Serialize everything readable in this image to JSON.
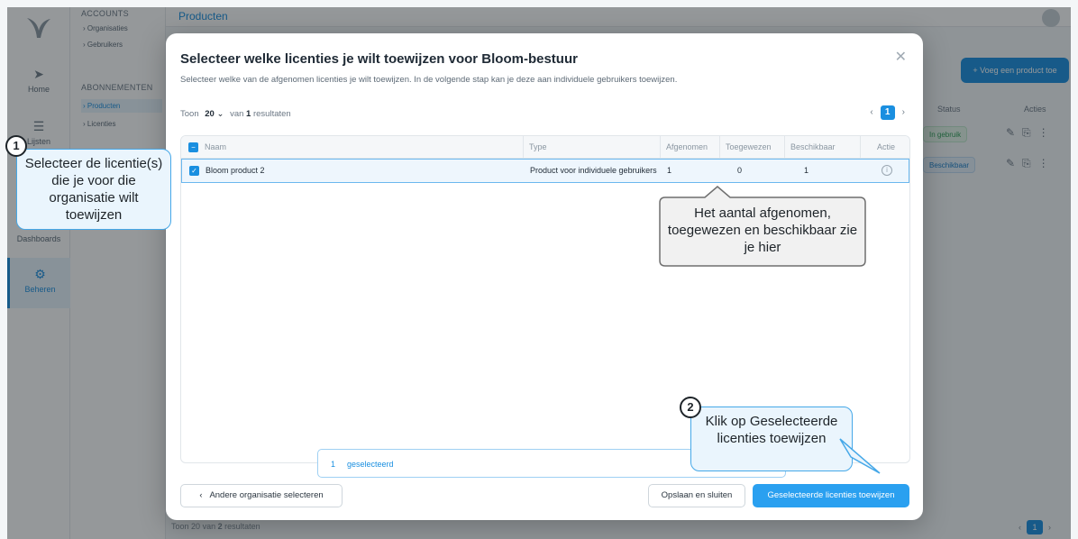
{
  "app": {
    "breadcrumb": "Producten",
    "rail": {
      "home": "Home",
      "lijsten": "Lijsten",
      "dashboards": "Dashboards",
      "beheren": "Beheren"
    },
    "subnav": {
      "accounts_head": "ACCOUNTS",
      "organisaties": "Organisaties",
      "gebruikers": "Gebruikers",
      "abonnementen_head": "ABONNEMENTEN",
      "producten": "Producten",
      "licenties": "Licenties"
    },
    "add_button": "+ Voeg een product toe",
    "table_headers": {
      "status": "Status",
      "acties": "Acties"
    },
    "rows": [
      {
        "status": "In gebruik"
      },
      {
        "status": "Beschikbaar"
      }
    ],
    "footer": {
      "toon": "Toon",
      "page_size": "20",
      "van": "van",
      "count": "2",
      "resultaten": "resultaten"
    },
    "pager": {
      "page": "1"
    }
  },
  "modal": {
    "title": "Selecteer welke licenties je wilt toewijzen voor Bloom-bestuur",
    "subtitle": "Selecteer welke van de afgenomen licenties je wilt toewijzen. In de volgende stap kan je deze aan individuele gebruikers toewijzen.",
    "toon": "Toon",
    "page_size": "20",
    "van": "van",
    "count": "1",
    "resultaten": "resultaten",
    "page": "1",
    "columns": {
      "naam": "Naam",
      "type": "Type",
      "afgenomen": "Afgenomen",
      "toegewezen": "Toegewezen",
      "beschikbaar": "Beschikbaar",
      "actie": "Actie"
    },
    "rows": [
      {
        "naam": "Bloom product 2",
        "type": "Product voor individuele gebruikers",
        "afgenomen": "1",
        "toegewezen": "0",
        "beschikbaar": "1"
      }
    ],
    "selected_count": "1",
    "selected_label": "geselecteerd",
    "back_button": "Andere organisatie selecteren",
    "save_button": "Opslaan en sluiten",
    "assign_button": "Geselecteerde licenties toewijzen"
  },
  "callouts": {
    "one": {
      "number": "1",
      "text": "Selecteer de licentie(s) die je voor die organisatie wilt toewijzen"
    },
    "info": {
      "text": "Het aantal afgenomen, toegewezen en beschikbaar zie je hier"
    },
    "two": {
      "number": "2",
      "text": "Klik op Geselecteerde licenties toewijzen"
    }
  }
}
